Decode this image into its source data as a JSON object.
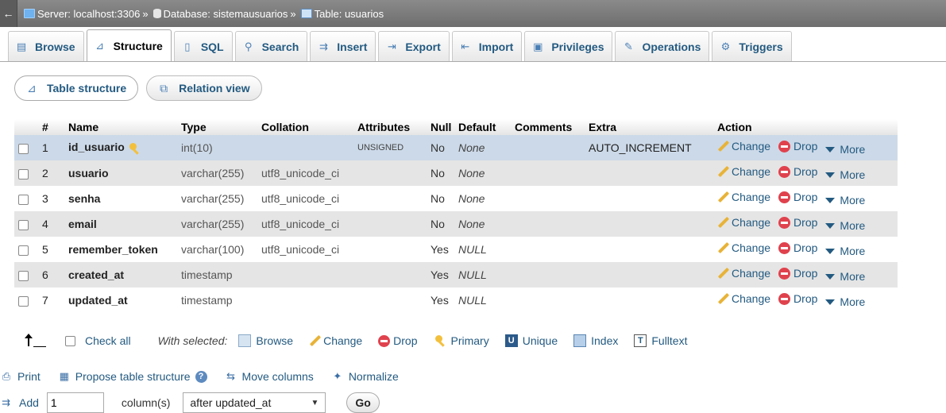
{
  "breadcrumb": {
    "server": "Server: localhost:3306",
    "database": "Database: sistemausuarios",
    "table": "Table: usuarios",
    "separator": "»"
  },
  "tabs": [
    {
      "label": "Browse",
      "icon": "browse-icon"
    },
    {
      "label": "Structure",
      "icon": "structure-icon",
      "active": true
    },
    {
      "label": "SQL",
      "icon": "sql-icon"
    },
    {
      "label": "Search",
      "icon": "search-icon"
    },
    {
      "label": "Insert",
      "icon": "insert-icon"
    },
    {
      "label": "Export",
      "icon": "export-icon"
    },
    {
      "label": "Import",
      "icon": "import-icon"
    },
    {
      "label": "Privileges",
      "icon": "privileges-icon"
    },
    {
      "label": "Operations",
      "icon": "operations-icon"
    },
    {
      "label": "Triggers",
      "icon": "triggers-icon"
    }
  ],
  "subtabs": [
    {
      "label": "Table structure",
      "icon": "table-structure-icon"
    },
    {
      "label": "Relation view",
      "icon": "relation-view-icon"
    }
  ],
  "columns": {
    "num": "#",
    "name": "Name",
    "type": "Type",
    "collation": "Collation",
    "attributes": "Attributes",
    "null": "Null",
    "default": "Default",
    "comments": "Comments",
    "extra": "Extra",
    "action": "Action"
  },
  "rows": [
    {
      "num": "1",
      "name": "id_usuario",
      "type": "int(10)",
      "collation": "",
      "attributes": "UNSIGNED",
      "null": "No",
      "default": "None",
      "extra": "AUTO_INCREMENT",
      "primary": true
    },
    {
      "num": "2",
      "name": "usuario",
      "type": "varchar(255)",
      "collation": "utf8_unicode_ci",
      "attributes": "",
      "null": "No",
      "default": "None",
      "extra": ""
    },
    {
      "num": "3",
      "name": "senha",
      "type": "varchar(255)",
      "collation": "utf8_unicode_ci",
      "attributes": "",
      "null": "No",
      "default": "None",
      "extra": ""
    },
    {
      "num": "4",
      "name": "email",
      "type": "varchar(255)",
      "collation": "utf8_unicode_ci",
      "attributes": "",
      "null": "No",
      "default": "None",
      "extra": ""
    },
    {
      "num": "5",
      "name": "remember_token",
      "type": "varchar(100)",
      "collation": "utf8_unicode_ci",
      "attributes": "",
      "null": "Yes",
      "default": "NULL",
      "extra": ""
    },
    {
      "num": "6",
      "name": "created_at",
      "type": "timestamp",
      "collation": "",
      "attributes": "",
      "null": "Yes",
      "default": "NULL",
      "extra": ""
    },
    {
      "num": "7",
      "name": "updated_at",
      "type": "timestamp",
      "collation": "",
      "attributes": "",
      "null": "Yes",
      "default": "NULL",
      "extra": ""
    }
  ],
  "row_actions": {
    "change": "Change",
    "drop": "Drop",
    "more": "More"
  },
  "selection": {
    "check_all": "Check all",
    "with_selected": "With selected:",
    "actions": [
      "Browse",
      "Change",
      "Drop",
      "Primary",
      "Unique",
      "Index",
      "Fulltext"
    ]
  },
  "links": {
    "print": "Print",
    "propose": "Propose table structure",
    "move": "Move columns",
    "normalize": "Normalize"
  },
  "add_column": {
    "label": "Add",
    "count": "1",
    "unit": "column(s)",
    "position": "after updated_at",
    "go": "Go"
  }
}
